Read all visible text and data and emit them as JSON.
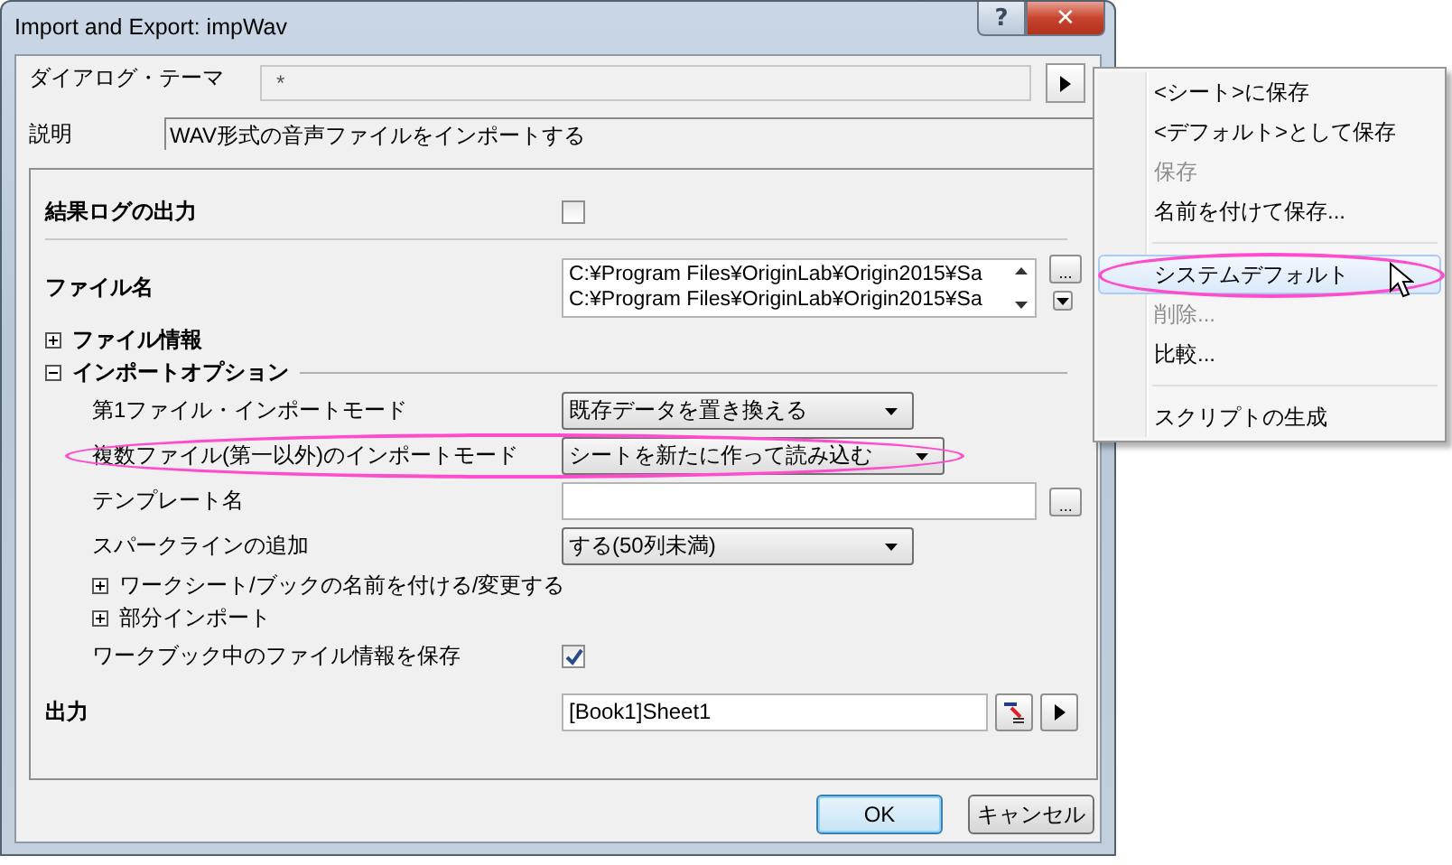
{
  "window": {
    "title": "Import and Export: impWav",
    "help_button": "?",
    "close_button": "✕"
  },
  "theme": {
    "label": "ダイアログ・テーマ",
    "value": "*"
  },
  "description": {
    "label": "説明",
    "value": "WAV形式の音声ファイルをインポートする"
  },
  "rows": [
    {
      "kind": "checkbox",
      "label": "結果ログの出力",
      "checked": false
    },
    {
      "kind": "files",
      "label": "ファイル名",
      "lines": [
        "C:¥Program Files¥OriginLab¥Origin2015¥Sa",
        "C:¥Program Files¥OriginLab¥Origin2015¥Sa"
      ],
      "browse": "..."
    },
    {
      "kind": "group",
      "label": "ファイル情報",
      "expanded": false
    },
    {
      "kind": "group",
      "label": "インポートオプション",
      "expanded": true,
      "children": [
        {
          "kind": "combo",
          "label": "第1ファイル・インポートモード",
          "value": "既存データを置き換える",
          "highlighted": false
        },
        {
          "kind": "combo",
          "label": "複数ファイル(第一以外)のインポートモード",
          "value": "シートを新たに作って読み込む",
          "highlighted": true
        },
        {
          "kind": "text",
          "label": "テンプレート名",
          "browse": "..."
        },
        {
          "kind": "combo",
          "label": "スパークラインの追加",
          "value": "する(50列未満)",
          "highlighted": false
        },
        {
          "kind": "group",
          "label": "ワークシート/ブックの名前を付ける/変更する",
          "expanded": false
        },
        {
          "kind": "group",
          "label": "部分インポート",
          "expanded": false
        },
        {
          "kind": "checkbox",
          "label": "ワークブック中のファイル情報を保存",
          "checked": true
        }
      ]
    },
    {
      "kind": "output",
      "label": "出力",
      "value": "[Book1]Sheet1"
    }
  ],
  "buttons": [
    {
      "label": "OK",
      "default": true
    },
    {
      "label": "キャンセル",
      "default": false
    }
  ],
  "menu": [
    {
      "kind": "item",
      "label": "<シート>に保存",
      "disabled": false,
      "selected": false,
      "highlighted": false
    },
    {
      "kind": "item",
      "label": "<デフォルト>として保存",
      "disabled": false,
      "selected": false,
      "highlighted": false
    },
    {
      "kind": "item",
      "label": "保存",
      "disabled": true,
      "selected": false,
      "highlighted": false
    },
    {
      "kind": "item",
      "label": "名前を付けて保存...",
      "disabled": false,
      "selected": false,
      "highlighted": false
    },
    {
      "kind": "separator"
    },
    {
      "kind": "item",
      "label": "システムデフォルト",
      "disabled": false,
      "selected": true,
      "highlighted": true
    },
    {
      "kind": "item",
      "label": "削除...",
      "disabled": true,
      "selected": false,
      "highlighted": false
    },
    {
      "kind": "item",
      "label": "比較...",
      "disabled": false,
      "selected": false,
      "highlighted": false
    },
    {
      "kind": "separator"
    },
    {
      "kind": "item",
      "label": "スクリプトの生成",
      "disabled": false,
      "selected": false,
      "highlighted": false
    }
  ]
}
